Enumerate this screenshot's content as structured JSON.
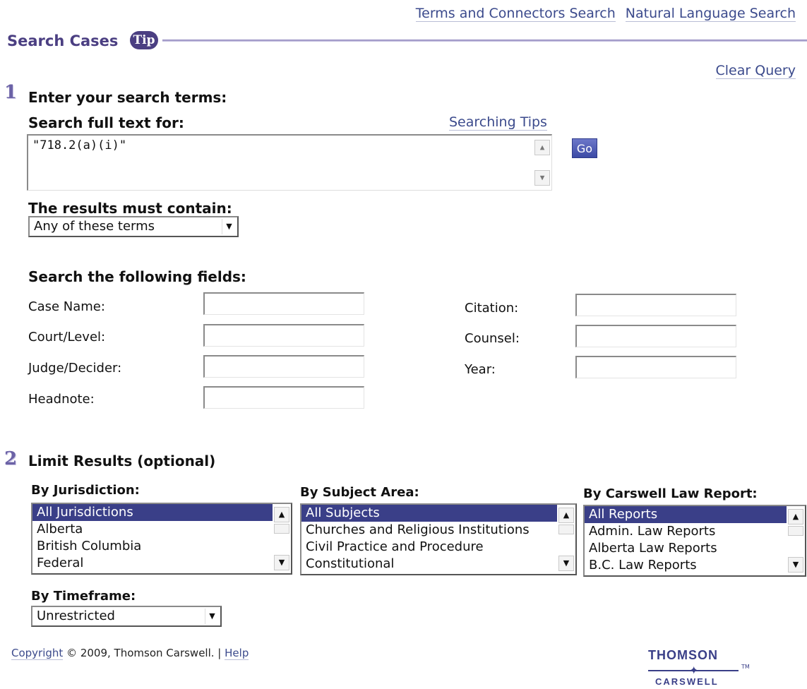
{
  "top_links": {
    "terms_connectors": "Terms and Connectors Search",
    "natural_language": "Natural Language Search"
  },
  "header": {
    "title": "Search Cases",
    "tip_label": "Tip"
  },
  "clear_query": "Clear Query",
  "step1": {
    "number": "1",
    "heading": "Enter your search terms:",
    "full_text_label": "Search full text for:",
    "searching_tips": "Searching Tips",
    "query_value": "\"718.2(a)(i)\"",
    "go_label": "Go",
    "must_contain_label": "The results must contain:",
    "must_contain_value": "Any of these terms",
    "fields_heading": "Search the following fields:",
    "fields": {
      "case_name": "Case Name:",
      "court_level": "Court/Level:",
      "judge_decider": "Judge/Decider:",
      "headnote": "Headnote:",
      "citation": "Citation:",
      "counsel": "Counsel:",
      "year": "Year:"
    }
  },
  "step2": {
    "number": "2",
    "heading": "Limit Results (optional)",
    "jurisdiction": {
      "label": "By Jurisdiction:",
      "options": [
        "All Jurisdictions",
        "Alberta",
        "British Columbia",
        "Federal"
      ]
    },
    "subject": {
      "label": "By Subject Area:",
      "options": [
        "All Subjects",
        "Churches and Religious Institutions",
        "Civil Practice and Procedure",
        "Constitutional"
      ]
    },
    "report": {
      "label": "By Carswell Law Report:",
      "options": [
        "All Reports",
        "Admin. Law Reports",
        "Alberta Law Reports",
        "B.C. Law Reports"
      ]
    },
    "timeframe": {
      "label": "By Timeframe:",
      "value": "Unrestricted"
    }
  },
  "footer": {
    "copyright_link": "Copyright",
    "copyright_text": "© 2009, Thomson Carswell. |",
    "help": "Help"
  },
  "logo": {
    "top": "THOMSON",
    "bottom": "CARSWELL",
    "tm": "TM"
  },
  "colors": {
    "accent": "#4b3f82",
    "selection": "#3a3f88",
    "link": "#3b4a8c"
  }
}
